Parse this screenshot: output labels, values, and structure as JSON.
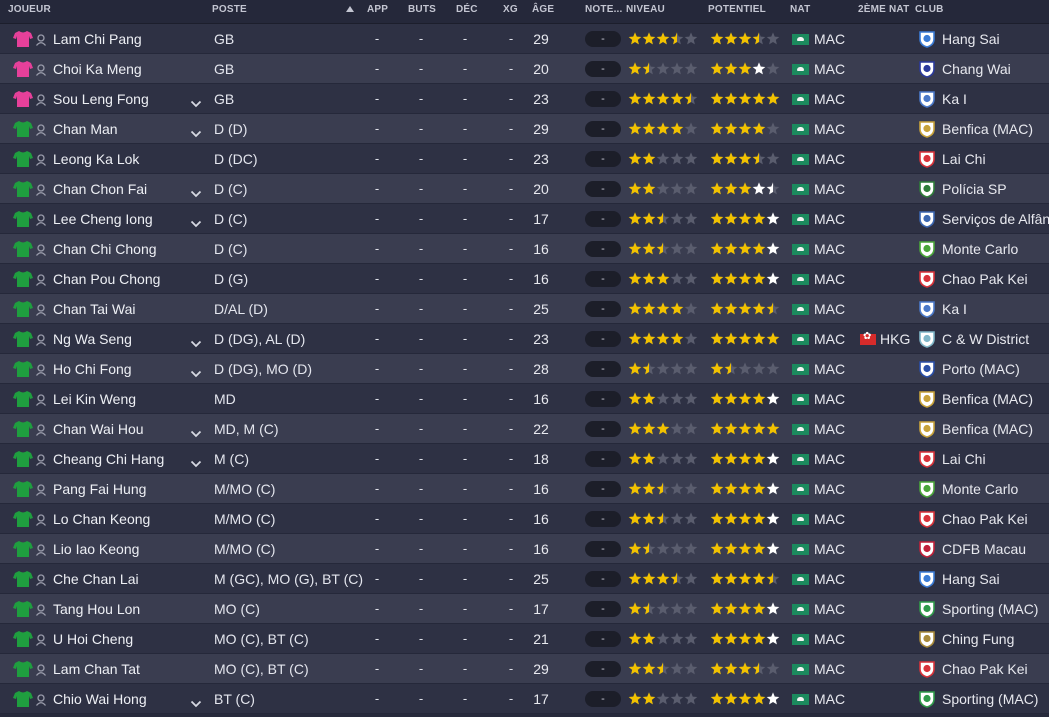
{
  "headers": {
    "joueur": "JOUEUR",
    "poste": "POSTE",
    "app": "APP",
    "buts": "BUTS",
    "dec": "DÉC",
    "xg": "XG",
    "age": "ÂGE",
    "note": "NOTE...",
    "niveau": "NIVEAU",
    "potentiel": "POTENTIEL",
    "nat": "NAT",
    "nat2": "2ÈME NAT",
    "club": "CLUB"
  },
  "colors": {
    "gk_shirt": "#e6409a",
    "field_shirt": "#1f9e3f",
    "star_gold": "#f2c200",
    "star_white": "#ffffff",
    "star_empty": "#5a5d6e",
    "flag_mac": "#1c8a5e",
    "flag_hkg": "#d62b2b"
  },
  "icons": {
    "shirt": "shirt-icon",
    "person": "person-icon",
    "expand": "chevron-down-icon",
    "star": "star-icon",
    "club": "club-crest-icon"
  },
  "players": [
    {
      "name": "Lam Chi Pang",
      "poste": "GB",
      "app": "-",
      "buts": "-",
      "dec": "-",
      "xg": "-",
      "age": "29",
      "note": "-",
      "niveau": 3.5,
      "potentiel": 3.5,
      "pot_white_from": null,
      "nat": "MAC",
      "nat2": "",
      "club": "Hang Sai",
      "shirt": "gk",
      "expand": false,
      "club_color": "#3a7bd5"
    },
    {
      "name": "Choi Ka Meng",
      "poste": "GB",
      "app": "-",
      "buts": "-",
      "dec": "-",
      "xg": "-",
      "age": "20",
      "note": "-",
      "niveau": 1.5,
      "potentiel": 4,
      "pot_white_from": 3,
      "nat": "MAC",
      "nat2": "",
      "club": "Chang Wai",
      "shirt": "gk",
      "expand": false,
      "club_color": "#2b3a9c"
    },
    {
      "name": "Sou Leng Fong",
      "poste": "GB",
      "app": "-",
      "buts": "-",
      "dec": "-",
      "xg": "-",
      "age": "23",
      "note": "-",
      "niveau": 4.5,
      "potentiel": 5,
      "pot_white_from": null,
      "nat": "MAC",
      "nat2": "",
      "club": "Ka I",
      "shirt": "gk",
      "expand": true,
      "club_color": "#4a78c8"
    },
    {
      "name": "Chan Man",
      "poste": "D (D)",
      "app": "-",
      "buts": "-",
      "dec": "-",
      "xg": "-",
      "age": "29",
      "note": "-",
      "niveau": 4,
      "potentiel": 4,
      "pot_white_from": null,
      "nat": "MAC",
      "nat2": "",
      "club": "Benfica (MAC)",
      "shirt": "field",
      "expand": true,
      "club_color": "#c7a23a"
    },
    {
      "name": "Leong Ka Lok",
      "poste": "D (DC)",
      "app": "-",
      "buts": "-",
      "dec": "-",
      "xg": "-",
      "age": "23",
      "note": "-",
      "niveau": 2,
      "potentiel": 3.5,
      "pot_white_from": null,
      "nat": "MAC",
      "nat2": "",
      "club": "Lai Chi",
      "shirt": "field",
      "expand": false,
      "club_color": "#d8323a"
    },
    {
      "name": "Chan Chon Fai",
      "poste": "D (C)",
      "app": "-",
      "buts": "-",
      "dec": "-",
      "xg": "-",
      "age": "20",
      "note": "-",
      "niveau": 2,
      "potentiel": 4.5,
      "pot_white_from": 3,
      "nat": "MAC",
      "nat2": "",
      "club": "Polícia SP",
      "shirt": "field",
      "expand": true,
      "club_color": "#2f7d3a"
    },
    {
      "name": "Lee Cheng Iong",
      "poste": "D (C)",
      "app": "-",
      "buts": "-",
      "dec": "-",
      "xg": "-",
      "age": "17",
      "note": "-",
      "niveau": 2.5,
      "potentiel": 5,
      "pot_white_from": 4,
      "nat": "MAC",
      "nat2": "",
      "club": "Serviços de Alfân...",
      "shirt": "field",
      "expand": true,
      "club_color": "#3b66b0"
    },
    {
      "name": "Chan Chi Chong",
      "poste": "D (C)",
      "app": "-",
      "buts": "-",
      "dec": "-",
      "xg": "-",
      "age": "16",
      "note": "-",
      "niveau": 2.5,
      "potentiel": 5,
      "pot_white_from": 4,
      "nat": "MAC",
      "nat2": "",
      "club": "Monte Carlo",
      "shirt": "field",
      "expand": false,
      "club_color": "#4aa53a"
    },
    {
      "name": "Chan Pou Chong",
      "poste": "D (G)",
      "app": "-",
      "buts": "-",
      "dec": "-",
      "xg": "-",
      "age": "16",
      "note": "-",
      "niveau": 3,
      "potentiel": 5,
      "pot_white_from": 4,
      "nat": "MAC",
      "nat2": "",
      "club": "Chao Pak Kei",
      "shirt": "field",
      "expand": false,
      "club_color": "#d8323a"
    },
    {
      "name": "Chan Tai Wai",
      "poste": "D/AL (D)",
      "app": "-",
      "buts": "-",
      "dec": "-",
      "xg": "-",
      "age": "25",
      "note": "-",
      "niveau": 4,
      "potentiel": 4.5,
      "pot_white_from": null,
      "nat": "MAC",
      "nat2": "",
      "club": "Ka I",
      "shirt": "field",
      "expand": false,
      "club_color": "#4a78c8"
    },
    {
      "name": "Ng Wa Seng",
      "poste": "D (DG), AL (D)",
      "app": "-",
      "buts": "-",
      "dec": "-",
      "xg": "-",
      "age": "23",
      "note": "-",
      "niveau": 4,
      "potentiel": 5,
      "pot_white_from": null,
      "nat": "MAC",
      "nat2": "HKG",
      "club": "C & W District",
      "shirt": "field",
      "expand": true,
      "club_color": "#7fb6c8"
    },
    {
      "name": "Ho Chi Fong",
      "poste": "D (DG), MO (D)",
      "app": "-",
      "buts": "-",
      "dec": "-",
      "xg": "-",
      "age": "28",
      "note": "-",
      "niveau": 1.5,
      "potentiel": 1.5,
      "pot_white_from": null,
      "nat": "MAC",
      "nat2": "",
      "club": "Porto (MAC)",
      "shirt": "field",
      "expand": true,
      "club_color": "#2a4fa8"
    },
    {
      "name": "Lei Kin Weng",
      "poste": "MD",
      "app": "-",
      "buts": "-",
      "dec": "-",
      "xg": "-",
      "age": "16",
      "note": "-",
      "niveau": 2,
      "potentiel": 5,
      "pot_white_from": 4,
      "nat": "MAC",
      "nat2": "",
      "club": "Benfica (MAC)",
      "shirt": "field",
      "expand": false,
      "club_color": "#c7a23a"
    },
    {
      "name": "Chan Wai Hou",
      "poste": "MD, M (C)",
      "app": "-",
      "buts": "-",
      "dec": "-",
      "xg": "-",
      "age": "22",
      "note": "-",
      "niveau": 3,
      "potentiel": 5,
      "pot_white_from": null,
      "nat": "MAC",
      "nat2": "",
      "club": "Benfica (MAC)",
      "shirt": "field",
      "expand": true,
      "club_color": "#c7a23a"
    },
    {
      "name": "Cheang Chi Hang",
      "poste": "M (C)",
      "app": "-",
      "buts": "-",
      "dec": "-",
      "xg": "-",
      "age": "18",
      "note": "-",
      "niveau": 2,
      "potentiel": 5,
      "pot_white_from": 4,
      "nat": "MAC",
      "nat2": "",
      "club": "Lai Chi",
      "shirt": "field",
      "expand": true,
      "club_color": "#d8323a"
    },
    {
      "name": "Pang Fai Hung",
      "poste": "M/MO (C)",
      "app": "-",
      "buts": "-",
      "dec": "-",
      "xg": "-",
      "age": "16",
      "note": "-",
      "niveau": 2.5,
      "potentiel": 5,
      "pot_white_from": 4,
      "nat": "MAC",
      "nat2": "",
      "club": "Monte Carlo",
      "shirt": "field",
      "expand": false,
      "club_color": "#4aa53a"
    },
    {
      "name": "Lo Chan Keong",
      "poste": "M/MO (C)",
      "app": "-",
      "buts": "-",
      "dec": "-",
      "xg": "-",
      "age": "16",
      "note": "-",
      "niveau": 2.5,
      "potentiel": 5,
      "pot_white_from": 4,
      "nat": "MAC",
      "nat2": "",
      "club": "Chao Pak Kei",
      "shirt": "field",
      "expand": false,
      "club_color": "#d8323a"
    },
    {
      "name": "Lio Iao Keong",
      "poste": "M/MO (C)",
      "app": "-",
      "buts": "-",
      "dec": "-",
      "xg": "-",
      "age": "16",
      "note": "-",
      "niveau": 1.5,
      "potentiel": 5,
      "pot_white_from": 4,
      "nat": "MAC",
      "nat2": "",
      "club": "CDFB Macau",
      "shirt": "field",
      "expand": false,
      "club_color": "#c0203a"
    },
    {
      "name": "Che Chan Lai",
      "poste": "M (GC), MO (G), BT (C)",
      "app": "-",
      "buts": "-",
      "dec": "-",
      "xg": "-",
      "age": "25",
      "note": "-",
      "niveau": 3.5,
      "potentiel": 4.5,
      "pot_white_from": null,
      "nat": "MAC",
      "nat2": "",
      "club": "Hang Sai",
      "shirt": "field",
      "expand": false,
      "club_color": "#3a7bd5"
    },
    {
      "name": "Tang Hou Lon",
      "poste": "MO (C)",
      "app": "-",
      "buts": "-",
      "dec": "-",
      "xg": "-",
      "age": "17",
      "note": "-",
      "niveau": 1.5,
      "potentiel": 5,
      "pot_white_from": 4,
      "nat": "MAC",
      "nat2": "",
      "club": "Sporting (MAC)",
      "shirt": "field",
      "expand": false,
      "club_color": "#2f9a4a"
    },
    {
      "name": "U Hoi Cheng",
      "poste": "MO (C), BT (C)",
      "app": "-",
      "buts": "-",
      "dec": "-",
      "xg": "-",
      "age": "21",
      "note": "-",
      "niveau": 2,
      "potentiel": 5,
      "pot_white_from": 4,
      "nat": "MAC",
      "nat2": "",
      "club": "Ching Fung",
      "shirt": "field",
      "expand": false,
      "club_color": "#a88a3a"
    },
    {
      "name": "Lam Chan Tat",
      "poste": "MO (C), BT (C)",
      "app": "-",
      "buts": "-",
      "dec": "-",
      "xg": "-",
      "age": "29",
      "note": "-",
      "niveau": 2.5,
      "potentiel": 3.5,
      "pot_white_from": null,
      "nat": "MAC",
      "nat2": "",
      "club": "Chao Pak Kei",
      "shirt": "field",
      "expand": false,
      "club_color": "#d8323a"
    },
    {
      "name": "Chio Wai Hong",
      "poste": "BT (C)",
      "app": "-",
      "buts": "-",
      "dec": "-",
      "xg": "-",
      "age": "17",
      "note": "-",
      "niveau": 2,
      "potentiel": 5,
      "pot_white_from": 4,
      "nat": "MAC",
      "nat2": "",
      "club": "Sporting (MAC)",
      "shirt": "field",
      "expand": true,
      "club_color": "#2f9a4a"
    }
  ]
}
